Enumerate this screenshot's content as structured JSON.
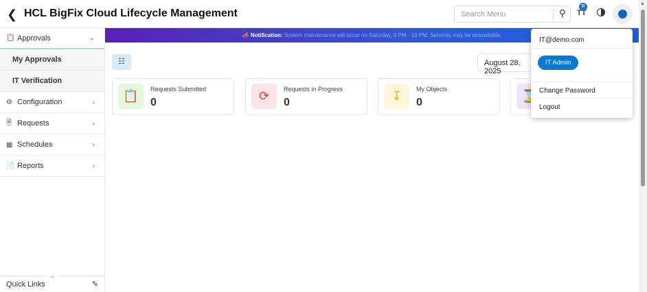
{
  "header": {
    "title": "HCL BigFix Cloud Lifecycle Management",
    "search_placeholder": "Search Menu",
    "text_size_badge": "R",
    "text_size_label": "TT"
  },
  "sidebar": {
    "items": [
      {
        "label": "Approvals",
        "icon": "approvals-icon",
        "expanded": true,
        "children": [
          "My Approvals",
          "IT Verification"
        ]
      },
      {
        "label": "Configuration",
        "icon": "configuration-icon"
      },
      {
        "label": "Requests",
        "icon": "requests-icon"
      },
      {
        "label": "Schedules",
        "icon": "schedules-icon"
      },
      {
        "label": "Reports",
        "icon": "reports-icon"
      }
    ],
    "quick_links": "Quick Links"
  },
  "notification": {
    "label": "Notification:",
    "message": "System maintenance will occur on Saturday, 8 PM - 10 PM. Services may be unavailable."
  },
  "date": "August 28, 2025",
  "cards": [
    {
      "label": "Requests Submitted",
      "value": "0",
      "color": "#e3f8dc",
      "icon_color": "#3cc13b"
    },
    {
      "label": "Requests in Progress",
      "value": "0",
      "color": "#fde4e4",
      "icon_color": "#e53935"
    },
    {
      "label": "My Objects",
      "value": "0",
      "color": "#fdf6d8",
      "icon_color": "#f0b400"
    },
    {
      "label": "",
      "value": "",
      "color": "#ece4fd",
      "icon_color": "#7e6ae0"
    }
  ],
  "user_menu": {
    "email": "IT@demo.com",
    "role": "IT Admin",
    "change_password": "Change Password",
    "logout": "Logout"
  }
}
